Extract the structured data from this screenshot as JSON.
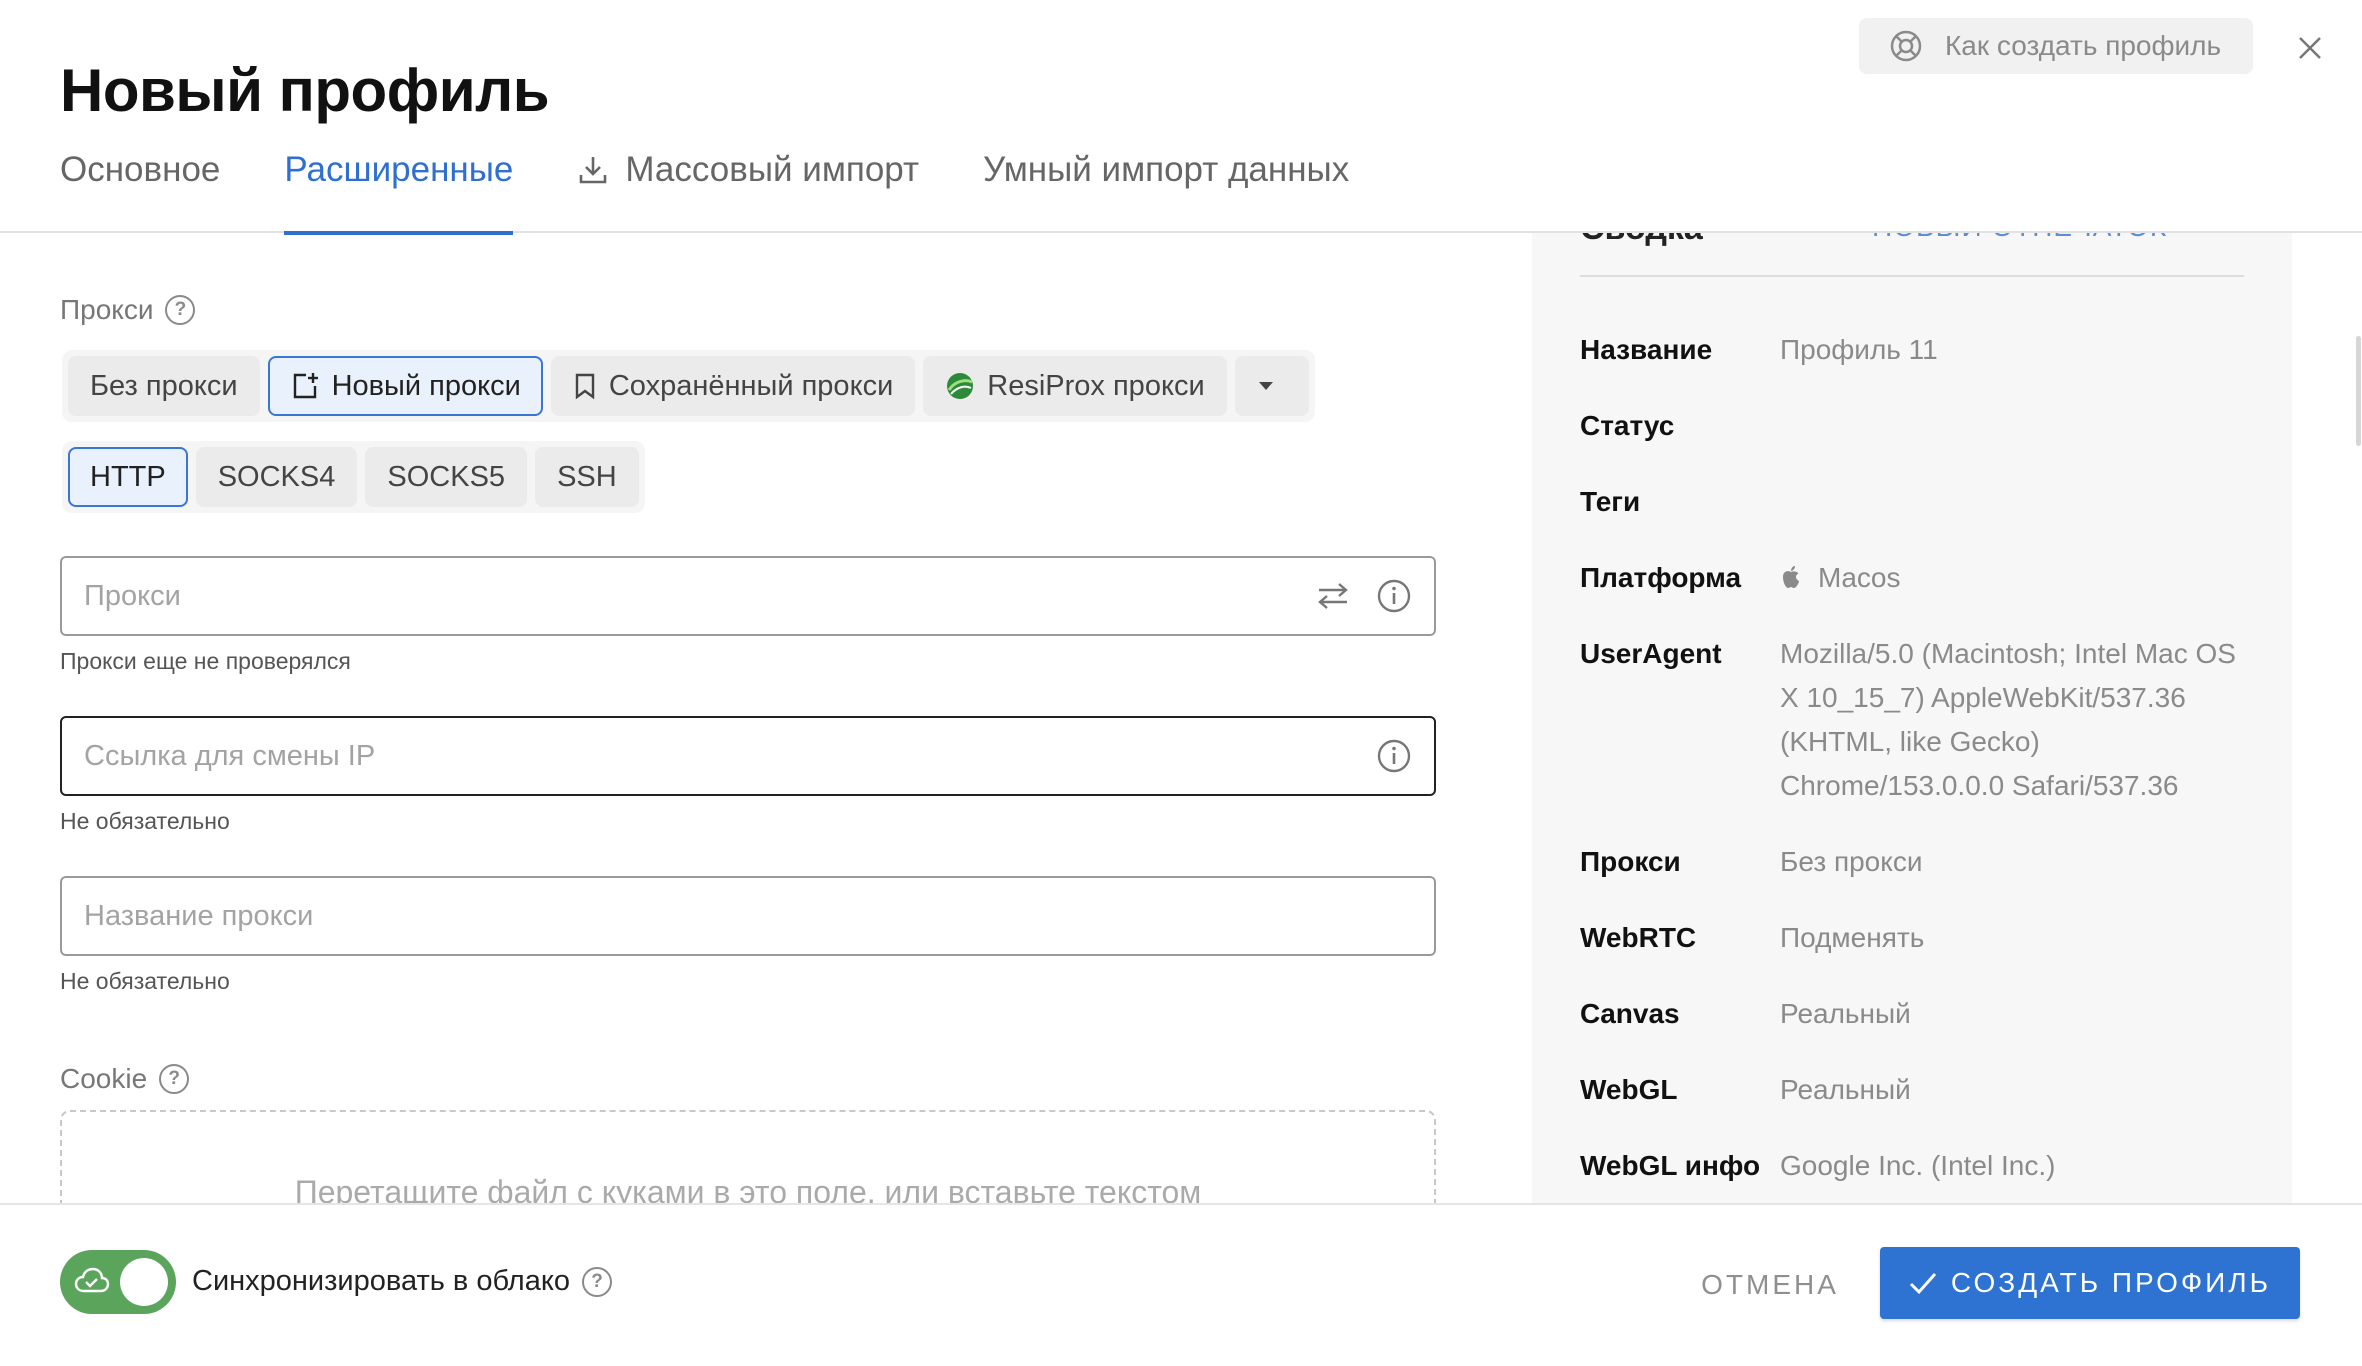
{
  "header": {
    "title": "Новый профиль",
    "help_label": "Как создать профиль",
    "tabs": [
      {
        "label": "Основное"
      },
      {
        "label": "Расширенные"
      },
      {
        "label": "Массовый импорт"
      },
      {
        "label": "Умный импорт данных"
      }
    ]
  },
  "proxy": {
    "section_label": "Прокси",
    "modes": [
      "Без прокси",
      "Новый прокси",
      "Сохранённый прокси",
      "ResiProx прокси"
    ],
    "types": [
      "HTTP",
      "SOCKS4",
      "SOCKS5",
      "SSH"
    ],
    "proxy_placeholder": "Прокси",
    "proxy_hint": "Прокси еще не проверялся",
    "ip_link_placeholder": "Ссылка для смены IP",
    "ip_link_hint": "Не обязательно",
    "name_placeholder": "Название прокси",
    "name_hint": "Не обязательно"
  },
  "cookie": {
    "section_label": "Cookie",
    "dropzone_text": "Перетащите файл с куками в это поле, или вставьте текстом"
  },
  "summary": {
    "heading": "Сводка",
    "heading_link": "НОВЫЙ ОТПЕЧАТОК",
    "rows": [
      {
        "key": "Название",
        "value": "Профиль 11"
      },
      {
        "key": "Статус",
        "value": ""
      },
      {
        "key": "Теги",
        "value": ""
      },
      {
        "key": "Платформа",
        "value": "Macos"
      },
      {
        "key": "UserAgent",
        "value": "Mozilla/5.0 (Macintosh; Intel Mac OS X 10_15_7) AppleWebKit/537.36 (KHTML, like Gecko) Chrome/153.0.0.0 Safari/537.36"
      },
      {
        "key": "Прокси",
        "value": "Без прокси"
      },
      {
        "key": "WebRTC",
        "value": "Подменять"
      },
      {
        "key": "Canvas",
        "value": "Реальный"
      },
      {
        "key": "WebGL",
        "value": "Реальный"
      },
      {
        "key": "WebGL инфо",
        "value": "Google Inc. (Intel Inc.)"
      }
    ]
  },
  "footer": {
    "sync_label": "Синхронизировать в облако",
    "cancel_label": "ОТМЕНА",
    "create_label": "СОЗДАТЬ ПРОФИЛЬ"
  },
  "colors": {
    "accent": "#2f6fd1",
    "toggle_on": "#5aa55b",
    "primary_button": "#2e72d2"
  }
}
